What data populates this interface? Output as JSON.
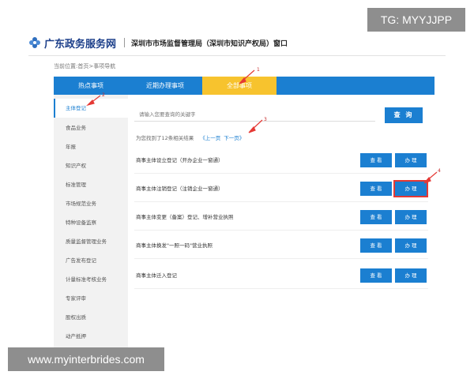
{
  "badges": {
    "top_right": "TG: MYYJJPP",
    "bottom_left": "www.myinterbrides.com"
  },
  "header": {
    "logo_icon": "flower-logo-icon",
    "site_name": "广东政务服务网",
    "bureau": "深圳市市场监督管理局（深圳市知识产权局）窗口"
  },
  "breadcrumb": "当前位置:首页>事项导航",
  "tabs": [
    {
      "label": "热点事项"
    },
    {
      "label": "近期办理事项"
    },
    {
      "label": "全部事项",
      "active": true
    }
  ],
  "sidebar": {
    "items": [
      {
        "label": "主体登记",
        "active": true
      },
      {
        "label": "食品业务"
      },
      {
        "label": "年报"
      },
      {
        "label": "知识产权"
      },
      {
        "label": "标准管理"
      },
      {
        "label": "市场规范业务"
      },
      {
        "label": "特种设备监察"
      },
      {
        "label": "质量监督管理业务"
      },
      {
        "label": "广告发布登记"
      },
      {
        "label": "计量标准考核业务"
      },
      {
        "label": "专家评审"
      },
      {
        "label": "股权出质"
      },
      {
        "label": "动产抵押"
      }
    ]
  },
  "search": {
    "placeholder": "请输入您要查询的关键字",
    "button_label": "查 询"
  },
  "results": {
    "summary": "为您找到了12条相关结果",
    "prev_label": "《上一页",
    "next_label": "下一页》"
  },
  "rows": [
    {
      "title": "商事主体设立登记（开办企业一窗通）",
      "view_label": "查 看",
      "handle_label": "办 理"
    },
    {
      "title": "商事主体注销登记（注销企业一窗通）",
      "view_label": "查 看",
      "handle_label": "办 理"
    },
    {
      "title": "商事主体变更（备案）登记、增补营业执照",
      "view_label": "查 看",
      "handle_label": "办 理"
    },
    {
      "title": "商事主体换发\"一照一码\"营业执照",
      "view_label": "查 看",
      "handle_label": "办 理"
    },
    {
      "title": "商事主体迁入登记",
      "view_label": "查 看",
      "handle_label": "办 理"
    }
  ],
  "annotations": [
    "1",
    "2",
    "3",
    "4"
  ],
  "colors": {
    "primary": "#1b7fd1",
    "active_tab": "#f7c32e",
    "annotation": "#e53935"
  }
}
